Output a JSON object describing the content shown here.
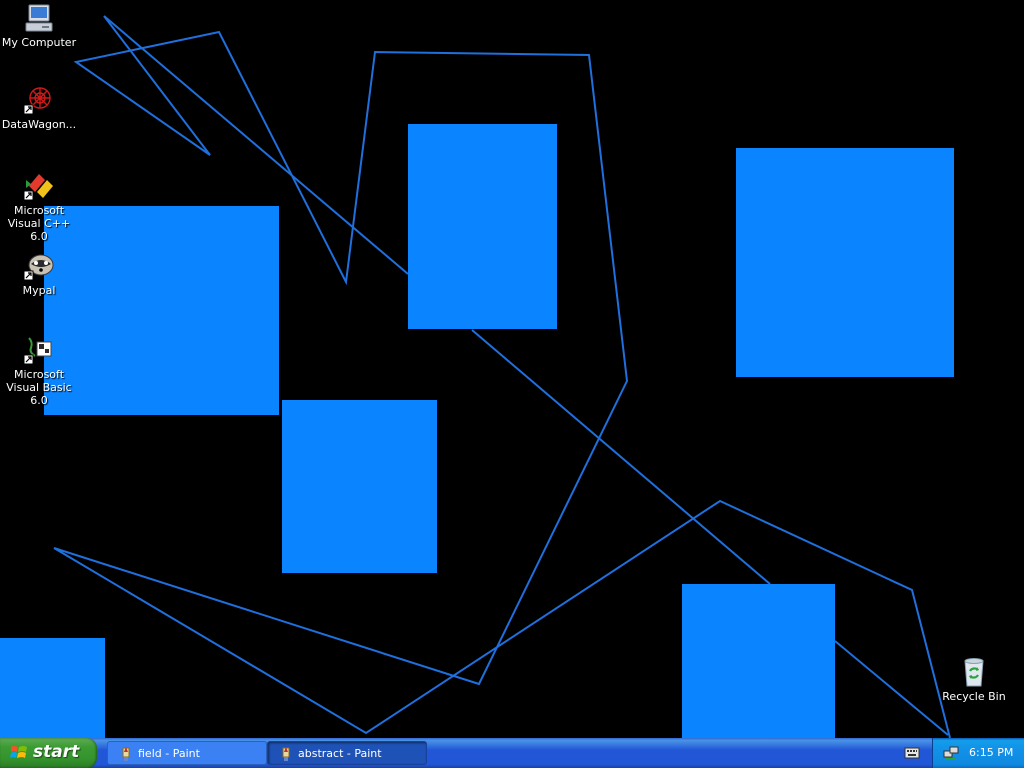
{
  "colors": {
    "desktop_background": "#000000",
    "shape_fill": "#0a84ff",
    "line_stroke": "#1f6fdc",
    "taskbar": "#2157d7",
    "start_green": "#3c9b33",
    "tray": "#1290e8"
  },
  "desktop": {
    "icons": [
      {
        "label": "My Computer",
        "icon": "my-computer-icon"
      },
      {
        "label": "DataWagon...",
        "icon": "datawagon-shortcut-icon"
      },
      {
        "label": "Microsoft Visual C++ 6.0",
        "icon": "visual-cpp-shortcut-icon"
      },
      {
        "label": "Mypal",
        "icon": "mypal-shortcut-icon"
      },
      {
        "label": "Microsoft Visual Basic 6.0",
        "icon": "visual-basic-shortcut-icon"
      },
      {
        "label": "Recycle Bin",
        "icon": "recycle-bin-icon"
      }
    ]
  },
  "taskbar": {
    "start_label": "start",
    "tasks": [
      {
        "label": "field - Paint",
        "icon": "paint-icon",
        "active": false
      },
      {
        "label": "abstract - Paint",
        "icon": "paint-icon",
        "active": true
      }
    ],
    "tray": {
      "keyboard_icon": "keyboard-icon",
      "network_icon": "network-icon",
      "clock": "6:15 PM"
    }
  }
}
